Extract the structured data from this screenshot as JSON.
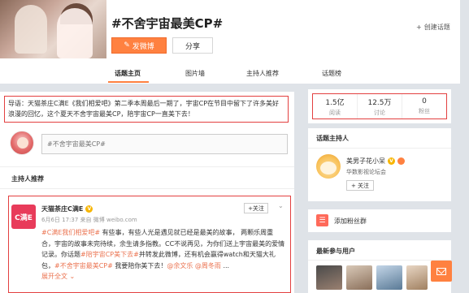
{
  "header": {
    "title": "#不舍宇宙最美CP#",
    "post_button": "发微博",
    "share_button": "分享",
    "create_link": "创建话题"
  },
  "tabs": [
    {
      "label": "话题主页",
      "active": true
    },
    {
      "label": "图片墙",
      "active": false
    },
    {
      "label": "主持人推荐",
      "active": false
    },
    {
      "label": "话题榜",
      "active": false
    }
  ],
  "guide": {
    "text": "导语：天猫茶庄C满E《我们相爱吧》第二季本周最后一期了，宇宙CP在节目中留下了许多美好浪漫的回忆，这个夏天不舍宇宙最美CP，陪宇宙CP一直美下去！"
  },
  "composer": {
    "input_value": "#不舍宇宙最美CP#"
  },
  "host_section": {
    "title": "主持人推荐"
  },
  "feed": {
    "avatar_text": "C满E",
    "name": "天猫茶庄C满E",
    "follow_label": "+关注",
    "meta": "6月6日 17:37 来自 微博 weibo.com",
    "text_tag1": "#C满E我们相爱吧#",
    "text_part1": " 有些事，有些人光是遇见就已经是最美的故事， 两颗乐周重合，宇宙的故事未完待续，余生请多指教。CC不说再见，为你们送上宇宙最美的爱情记录。你话题",
    "text_tag2": "#陪宇宙CP美下去#",
    "text_part2": "并转发此微博，还有机会赢得watch和天猫大礼包，",
    "text_tag3": "#不舍宇宙最美CP#",
    "text_part3": " 我要陪你美下去！",
    "mention1": "@余文乐",
    "mention2": "@周冬雨",
    "text_end": " ...",
    "more": "展开全文 ⌄"
  },
  "stats": [
    {
      "num": "1.5亿",
      "label": "阅读"
    },
    {
      "num": "12.5万",
      "label": "讨论"
    },
    {
      "num": "0",
      "label": "粉丝"
    }
  ],
  "host_card": {
    "title": "话题主持人",
    "name": "美男子花小呆",
    "desc": "华数影视论坛会",
    "follow_label": "+ 关注"
  },
  "fans": {
    "label": "添加粉丝群"
  },
  "recent": {
    "title": "最新参与用户"
  },
  "colors": {
    "accent": "#ff8140",
    "highlight_border": "#e34040",
    "link": "#eb7350"
  }
}
